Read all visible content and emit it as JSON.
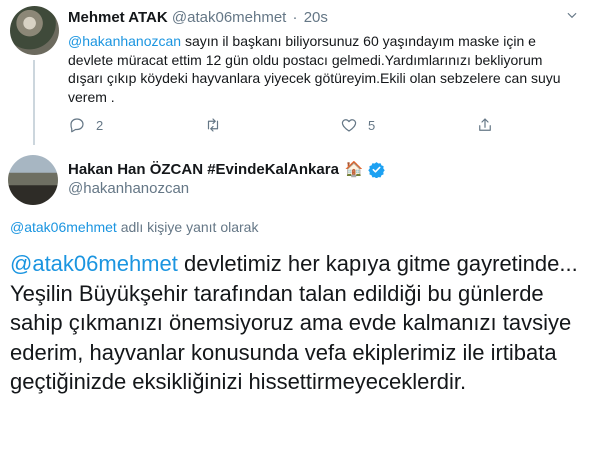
{
  "reply_tweet": {
    "author_name": "Mehmet ATAK",
    "author_handle": "@atak06mehmet",
    "separator": "·",
    "time": "20s",
    "mention": "@hakanhanozcan",
    "text": " sayın il başkanı biliyorsunuz 60 yaşındayım maske için e devlete müracat ettim 12 gün oldu postacı gelmedi.Yardımlarınızı bekliyorum dışarı çıkıp köydeki hayvanlara yiyecek götüreyim.Ekili olan sebzelere can suyu verem .",
    "reply_count": "2",
    "retweet_count": "",
    "like_count": "5"
  },
  "main_tweet": {
    "author_name": "Hakan Han ÖZCAN #EvindeKalAnkara",
    "author_emoji": "🏠",
    "author_handle": "@hakanhanozcan",
    "replying_to_handle": "@atak06mehmet",
    "replying_to_suffix": " adlı kişiye yanıt olarak",
    "mention": "@atak06mehmet",
    "text": " devletimiz her kapıya gitme gayretinde...\nYeşilin Büyükşehir tarafından talan edildiği bu günlerde sahip çıkmanızı önemsiyoruz ama evde kalmanızı tavsiye ederim, hayvanlar konusunda  vefa ekiplerimiz ile irtibata geçtiğinizde eksikliğinizi hissettirmeyeceklerdir."
  },
  "colors": {
    "link": "#1b95e0",
    "secondary_text": "#657786",
    "verified": "#1da1f2"
  }
}
